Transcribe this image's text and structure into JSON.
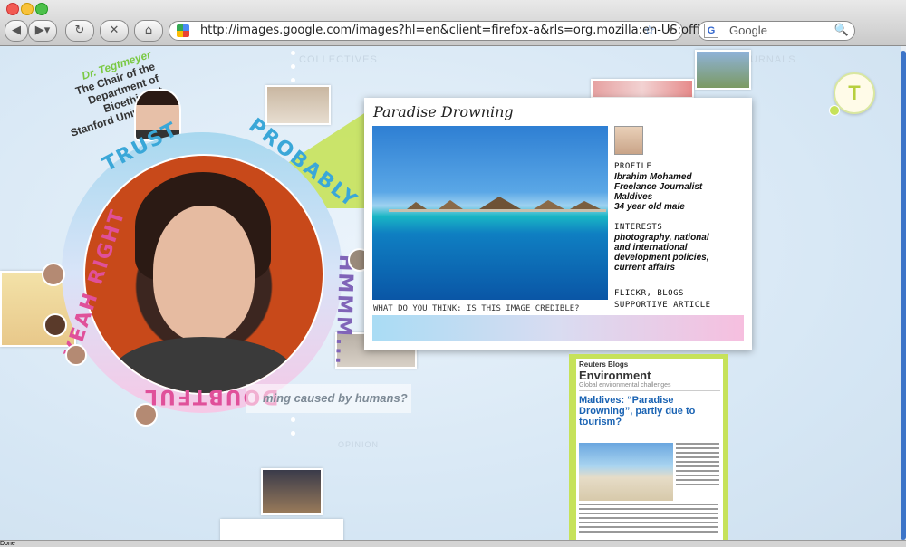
{
  "browser": {
    "url": "http://images.google.com/images?hl=en&client=firefox-a&rls=org.mozilla:en-US:official&hs=qY",
    "search_placeholder": "Google",
    "status": "Done"
  },
  "background": {
    "collectives": "COLLECTIVES",
    "journals": "URNALS",
    "opinion": "OPINION"
  },
  "doctor": {
    "name": "Dr. Tegtmeyer",
    "line1": "The Chair of the",
    "line2": "Department of",
    "line3": "Bioethics at",
    "line4": "Stanford University"
  },
  "ring_words": {
    "trust": "TRUST",
    "probably": "PROBABLY",
    "yeah_right": "YEAH RIGHT",
    "hmmm": "HMMM...",
    "doubtful": "DOUBTFUL"
  },
  "card": {
    "title": "Paradise Drowning",
    "profile_label": "PROFILE",
    "profile_lines": [
      "Ibrahim Mohamed",
      "Freelance Journalist",
      "Maldives",
      "34 year old male"
    ],
    "interests_label": "INTERESTS",
    "interests_lines": [
      "photography, national",
      "and international",
      "development policies,",
      "current affairs"
    ],
    "links_line1": "FLICKR, BLOGS",
    "links_line2": "SUPPORTIVE ARTICLE",
    "question": "WHAT DO YOU THINK: IS THIS IMAGE CREDIBLE?"
  },
  "article": {
    "source": "Reuters Blogs",
    "section": "Environment",
    "subtitle": "Global environmental challenges",
    "headline": "Maldives: “Paradise Drowning”, partly due to tourism?"
  },
  "side_question": "ming caused by humans?",
  "tbutton": "T",
  "colors": {
    "accent_green": "#c6e25a",
    "ring_blue": "#3aa7d8",
    "ring_pink": "#e0509a",
    "link_blue": "#1a63b3"
  }
}
